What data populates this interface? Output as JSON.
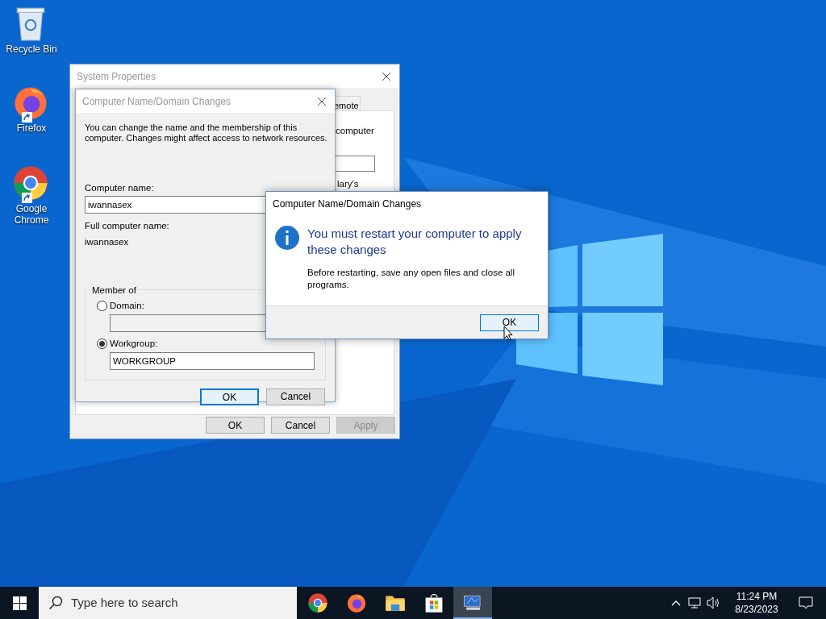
{
  "desktop_icons": [
    {
      "kind": "recycle",
      "label": "Recycle Bin",
      "shortcut": false
    },
    {
      "kind": "firefox",
      "label": "Firefox",
      "shortcut": true
    },
    {
      "kind": "chrome",
      "label": "Google Chrome",
      "shortcut": true
    }
  ],
  "system_properties": {
    "title": "System Properties",
    "tab_fragment": "emote",
    "text_fragments": [
      "computer",
      "lary's"
    ],
    "buttons": [
      {
        "label": "OK",
        "disabled": false
      },
      {
        "label": "Cancel",
        "disabled": false
      },
      {
        "label": "Apply",
        "disabled": true
      }
    ]
  },
  "name_dialog": {
    "title": "Computer Name/Domain Changes",
    "description": "You can change the name and the membership of this computer. Changes might affect access to network resources.",
    "computer_name_label": "Computer name:",
    "computer_name_value": "iwannasex",
    "full_name_label": "Full computer name:",
    "full_name_value": "iwannasex",
    "member_of_label": "Member of",
    "options": [
      {
        "label": "Domain:",
        "selected": false
      },
      {
        "label": "Workgroup:",
        "selected": true,
        "value": "WORKGROUP"
      }
    ],
    "buttons": [
      {
        "label": "OK",
        "default": true
      },
      {
        "label": "Cancel",
        "default": false
      }
    ]
  },
  "message_box": {
    "title": "Computer Name/Domain Changes",
    "heading": "You must restart your computer to apply these changes",
    "body": "Before restarting, save any open files and close all programs.",
    "button": {
      "label": "OK",
      "focused": true
    }
  },
  "taskbar": {
    "search_placeholder": "Type here to search",
    "apps": [
      {
        "kind": "chrome",
        "active": false
      },
      {
        "kind": "firefox",
        "active": false
      },
      {
        "kind": "folder",
        "active": false
      },
      {
        "kind": "store",
        "active": false
      },
      {
        "kind": "system",
        "active": true
      }
    ],
    "clock": {
      "time": "11:24 PM",
      "date": "8/23/2023"
    }
  }
}
